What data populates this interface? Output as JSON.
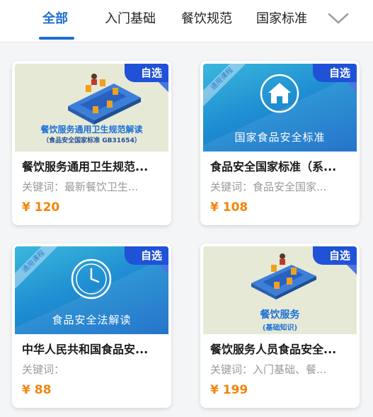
{
  "tabs": [
    {
      "label": "全部",
      "active": true
    },
    {
      "label": "入门基础",
      "active": false
    },
    {
      "label": "餐饮规范",
      "active": false
    },
    {
      "label": "国家标准",
      "active": false
    }
  ],
  "expand_icon": "chevron-down-icon",
  "colors": {
    "accent": "#1f6fcf",
    "badge": "#1f52d6",
    "price": "#f2850c"
  },
  "courses": [
    {
      "title": "餐饮服务通用卫生规范...",
      "keywords": "关键词：最新餐饮卫生...",
      "price": "¥ 120",
      "badge": "自选",
      "thumb_title": "餐饮服务通用卫生规范解读",
      "thumb_subtitle": "（食品安全国家标准 GB31654）"
    },
    {
      "title": "食品安全国家标准（系...",
      "keywords": "关键词：食品安全国家...",
      "price": "¥ 108",
      "badge": "自选",
      "ribbon": "通用课程",
      "thumb_caption": "国家食品安全标准"
    },
    {
      "title": "中华人民共和国食品安...",
      "keywords": "关键词：",
      "price": "¥ 88",
      "badge": "自选",
      "ribbon": "通用课程",
      "thumb_caption": "食品安全法解读"
    },
    {
      "title": "餐饮服务人员食品安全...",
      "keywords": "关键词：入门基础、餐...",
      "price": "¥ 199",
      "badge": "自选",
      "thumb_title": "餐饮服务",
      "thumb_subtitle": "(基础知识)"
    }
  ]
}
